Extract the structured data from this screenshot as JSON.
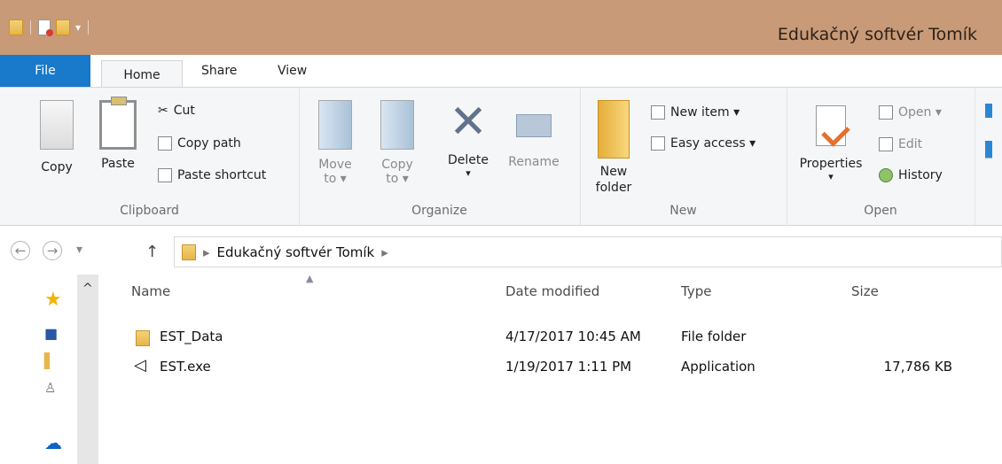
{
  "window": {
    "title": "Edukačný softvér Tomík",
    "quick_access": [
      "folder-icon",
      "properties-icon",
      "new-folder-icon"
    ],
    "quick_access_dropdown": "▾"
  },
  "tabs": [
    {
      "label": "File"
    },
    {
      "label": "Home"
    },
    {
      "label": "Share"
    },
    {
      "label": "View"
    }
  ],
  "ribbon": {
    "groups": [
      {
        "label": "Clipboard"
      },
      {
        "label": "Organize"
      },
      {
        "label": "New"
      },
      {
        "label": "Open"
      }
    ],
    "clipboard": {
      "copy": "Copy",
      "paste": "Paste",
      "cut": "Cut",
      "copy_path": "Copy path",
      "paste_shortcut": "Paste shortcut"
    },
    "organize": {
      "move_to": "Move\nto ▾",
      "copy_to": "Copy\nto ▾",
      "delete": "Delete",
      "delete_arrow": "▾",
      "rename": "Rename"
    },
    "new": {
      "new_folder": "New\nfolder",
      "new_item": "New item ▾",
      "easy_access": "Easy access ▾"
    },
    "open": {
      "properties": "Properties",
      "properties_arrow": "▾",
      "open": "Open ▾",
      "edit": "Edit",
      "history": "History"
    }
  },
  "address": {
    "back": "←",
    "forward": "→",
    "recent": "▾",
    "up": "↑",
    "path_sep1": "▸",
    "path": "Edukačný softvér Tomík",
    "path_sep2": "▸"
  },
  "sidebar": {
    "scroll_up": "^",
    "icons": [
      "favorites-star-icon",
      "computer-icon",
      "libraries-icon",
      "network-icon",
      "onedrive-icon"
    ]
  },
  "files": {
    "sort_indicator": "▲",
    "columns": [
      "Name",
      "Date modified",
      "Type",
      "Size"
    ],
    "rows": [
      {
        "name": "EST_Data",
        "date": "4/17/2017 10:45 AM",
        "type": "File folder",
        "size": ""
      },
      {
        "name": "EST.exe",
        "date": "1/19/2017 1:11 PM",
        "type": "Application",
        "size": "17,786 KB"
      }
    ]
  }
}
